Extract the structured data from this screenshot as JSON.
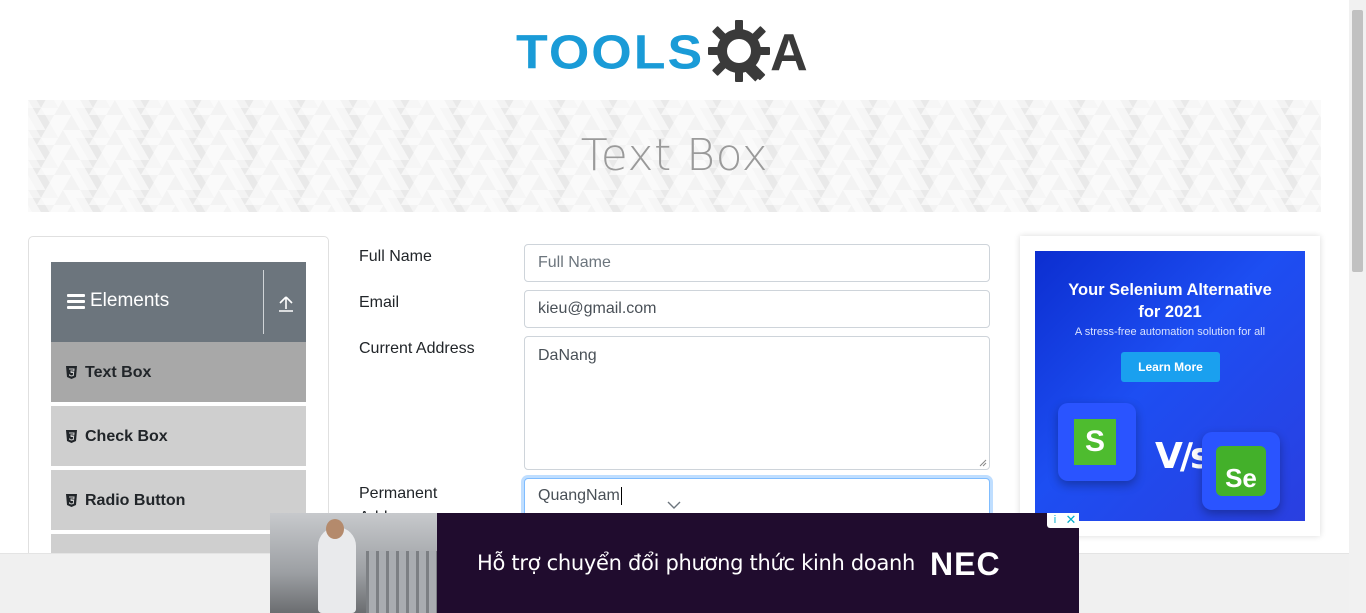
{
  "header": {
    "logo_text_left": "TOOLS",
    "logo_text_right": "A",
    "logo_alt": "ToolsQA"
  },
  "banner": {
    "title": "Text Box"
  },
  "sidebar": {
    "group_title": "Elements",
    "items": [
      {
        "label": "Text Box",
        "active": true
      },
      {
        "label": "Check Box",
        "active": false
      },
      {
        "label": "Radio Button",
        "active": false
      }
    ]
  },
  "form": {
    "full_name": {
      "label": "Full Name",
      "value": "",
      "placeholder": "Full Name"
    },
    "email": {
      "label": "Email",
      "value": "kieu@gmail.com"
    },
    "current_address": {
      "label": "Current Address",
      "value": "DaNang"
    },
    "permanent_address": {
      "label": "Permanent Address",
      "label_line1": "Permanent",
      "label_line2": "Address",
      "value": "QuangNam"
    }
  },
  "right_ad": {
    "headline_line1": "Your Selenium Alternative",
    "headline_line2": "for 2021",
    "subtext": "A stress-free automation solution for all",
    "cta": "Learn More",
    "left_logo_letter": "S",
    "vs_text": "V/s",
    "right_logo_text": "Se"
  },
  "bottom_ad": {
    "text": "Hỗ trợ chuyển đổi phương thức kinh doanh",
    "brand": "NEC",
    "info_icon": "i",
    "close_icon": "✕"
  },
  "colors": {
    "brand_blue": "#1a9bd7",
    "sidebar_header": "#6c757d",
    "active_item": "#a8a8a8",
    "item_bg": "#cfcfcf"
  }
}
